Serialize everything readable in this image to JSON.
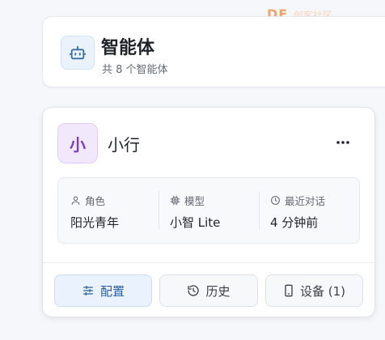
{
  "watermark": {
    "brand": "DF",
    "tail": "创客社区"
  },
  "header": {
    "icon": "robot-icon",
    "title": "智能体",
    "subtitle": "共 8 个智能体"
  },
  "agent": {
    "avatar_text": "小",
    "name": "小行",
    "more_icon": "more-horizontal-icon",
    "info": [
      {
        "icon": "user-icon",
        "label": "角色",
        "value": "阳光青年"
      },
      {
        "icon": "chip-icon",
        "label": "模型",
        "value": "小智 Lite"
      },
      {
        "icon": "clock-icon",
        "label": "最近对话",
        "value": "4 分钟前"
      }
    ],
    "actions": [
      {
        "icon": "sliders-icon",
        "label": "配置"
      },
      {
        "icon": "history-icon",
        "label": "历史"
      },
      {
        "icon": "device-icon",
        "label": "设备 (1)"
      }
    ]
  },
  "colors": {
    "accent": "#2b5fa0",
    "avatar_purple": "#7a3fc4",
    "watermark_orange": "#f0a46a"
  }
}
